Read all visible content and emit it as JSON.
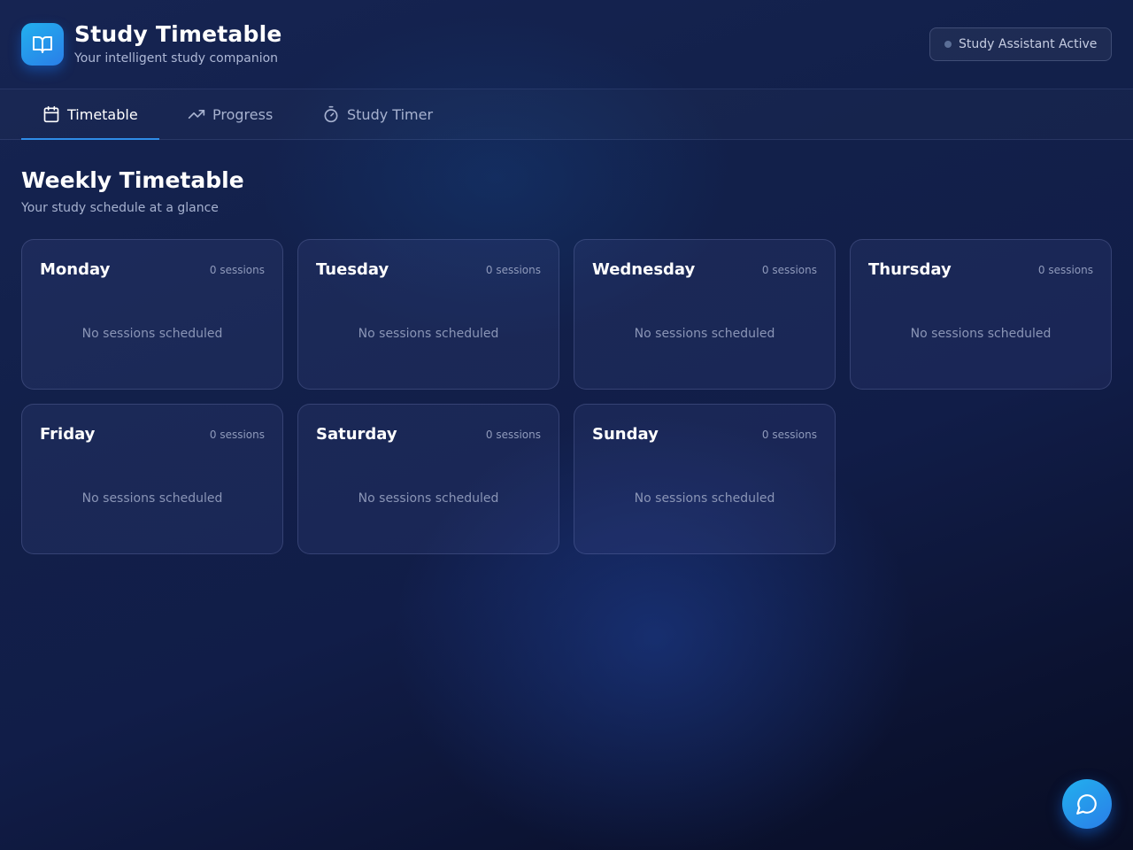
{
  "header": {
    "title": "Study Timetable",
    "subtitle": "Your intelligent study companion",
    "logo_icon": "book-open-icon",
    "status": "Study Assistant Active"
  },
  "tabs": [
    {
      "label": "Timetable",
      "icon": "calendar-icon",
      "active": true
    },
    {
      "label": "Progress",
      "icon": "trending-up-icon",
      "active": false
    },
    {
      "label": "Study Timer",
      "icon": "stopwatch-icon",
      "active": false
    }
  ],
  "section": {
    "title": "Weekly Timetable",
    "subtitle": "Your study schedule at a glance"
  },
  "days": [
    {
      "name": "Monday",
      "count": "0 sessions",
      "empty": "No sessions scheduled"
    },
    {
      "name": "Tuesday",
      "count": "0 sessions",
      "empty": "No sessions scheduled"
    },
    {
      "name": "Wednesday",
      "count": "0 sessions",
      "empty": "No sessions scheduled"
    },
    {
      "name": "Thursday",
      "count": "0 sessions",
      "empty": "No sessions scheduled"
    },
    {
      "name": "Friday",
      "count": "0 sessions",
      "empty": "No sessions scheduled"
    },
    {
      "name": "Saturday",
      "count": "0 sessions",
      "empty": "No sessions scheduled"
    },
    {
      "name": "Sunday",
      "count": "0 sessions",
      "empty": "No sessions scheduled"
    }
  ],
  "chat": {
    "icon": "chat-bubble-icon"
  },
  "colors": {
    "accent": "#2f8de8",
    "logo_gradient_start": "#22b0ee",
    "logo_gradient_end": "#2a7ee8",
    "background_dark": "#0b1230"
  }
}
